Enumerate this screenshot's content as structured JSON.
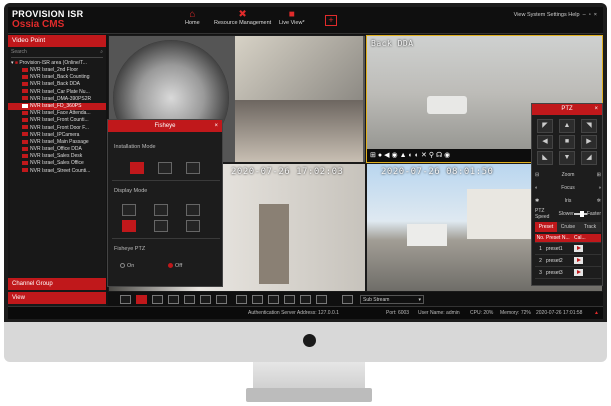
{
  "brand": {
    "line1": "PROVISION ISR",
    "line2": "Ossia CMS"
  },
  "nav": [
    {
      "label": "Home",
      "icon": "home-icon"
    },
    {
      "label": "Resource Management",
      "icon": "tools-icon"
    },
    {
      "label": "Live View*",
      "icon": "camera-icon"
    }
  ],
  "add_label": "+",
  "topright": "View  System Settings  Help",
  "sidebar": {
    "header": "Video Point",
    "search_placeholder": "Search",
    "root": "Provision-ISR area (Online/T...",
    "items": [
      "NVR Israel_2nd Floor",
      "NVR Israel_Back Counting",
      "NVR Israel_Back DDA",
      "NVR Israel_Car Plate Nu...",
      "NVR Israel_DMA-390PS2R",
      "NVR Israel_FD_360PS",
      "NVR Israel_Face Attenda...",
      "NVR Israel_Front Counti...",
      "NVR Israel_Front Door F...",
      "NVR Israel_IPCamera",
      "NVR Israel_Main Passage",
      "NVR Israel_Office DDA",
      "NVR Israel_Sales Desk",
      "NVR Israel_Sales Office",
      "NVR Israel_Street Counti..."
    ],
    "selected_index": 5,
    "channel_group": "Channel Group",
    "view": "View"
  },
  "osd": {
    "cam2": "Back DDA",
    "cam3": "2020-07-26 17:02:03",
    "cam4": "2020-07-26 08:01:50"
  },
  "fisheye": {
    "title": "Fisheye",
    "install_mode": "Installation Mode",
    "display_mode": "Display Mode",
    "ptz": "Fisheye PTZ",
    "on": "On",
    "off": "Off"
  },
  "ptz": {
    "title": "PTZ",
    "zoom": "Zoom",
    "focus": "Focus",
    "iris": "Iris",
    "speed": "PTZ Speed",
    "speed_slow": "Slower",
    "speed_fast": "Faster",
    "tabs": [
      "Preset",
      "Cruise",
      "Track"
    ],
    "cols": [
      "No.",
      "Preset N...",
      "Cal..."
    ],
    "presets": [
      {
        "no": "1",
        "name": "preset1"
      },
      {
        "no": "2",
        "name": "preset2"
      },
      {
        "no": "3",
        "name": "preset3"
      }
    ]
  },
  "toolbar": {
    "tb2": "4",
    "tb4": "16",
    "tb5": "25",
    "tb6": "36",
    "stream": "Sub Stream"
  },
  "status": {
    "auth": "Authentication Server  Address: 127.0.0.1",
    "port": "Port: 6003",
    "user": "User Name: admin",
    "cpu": "CPU: 20%",
    "memory": "Memory: 72%",
    "time": "2020-07-26 17:01:58"
  },
  "colors": {
    "accent": "#c0181b"
  }
}
